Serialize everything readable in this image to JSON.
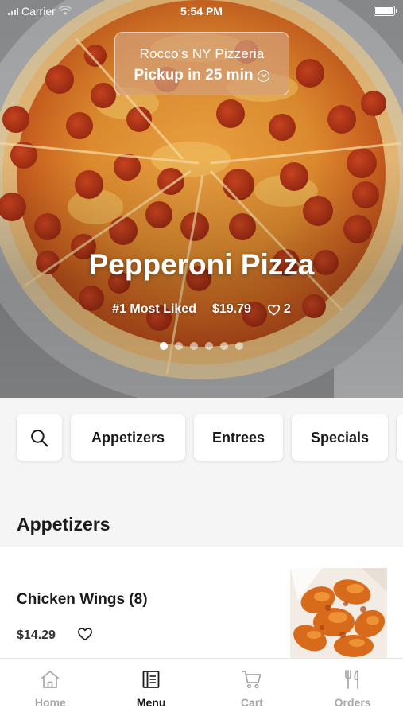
{
  "status_bar": {
    "carrier": "Carrier",
    "time": "5:54 PM"
  },
  "store": {
    "name": "Rocco's NY Pizzeria",
    "pickup": "Pickup in 25 min"
  },
  "featured": {
    "title": "Pepperoni Pizza",
    "badge": "#1 Most Liked",
    "price": "$19.79",
    "likes": "2",
    "slide_count": 6,
    "active_slide": 1
  },
  "categories": [
    "Appetizers",
    "Entrees",
    "Specials"
  ],
  "section": {
    "title": "Appetizers"
  },
  "items": [
    {
      "name": "Chicken Wings (8)",
      "price": "$14.29"
    }
  ],
  "tabs": [
    {
      "label": "Home",
      "icon": "home-icon",
      "active": false
    },
    {
      "label": "Menu",
      "icon": "menu-icon",
      "active": true
    },
    {
      "label": "Cart",
      "icon": "cart-icon",
      "active": false
    },
    {
      "label": "Orders",
      "icon": "utensils-icon",
      "active": false
    }
  ],
  "colors": {
    "active_tab": "#1a1a1a",
    "inactive_tab": "#a7a7a7",
    "pill_bg": "#d6a078"
  }
}
